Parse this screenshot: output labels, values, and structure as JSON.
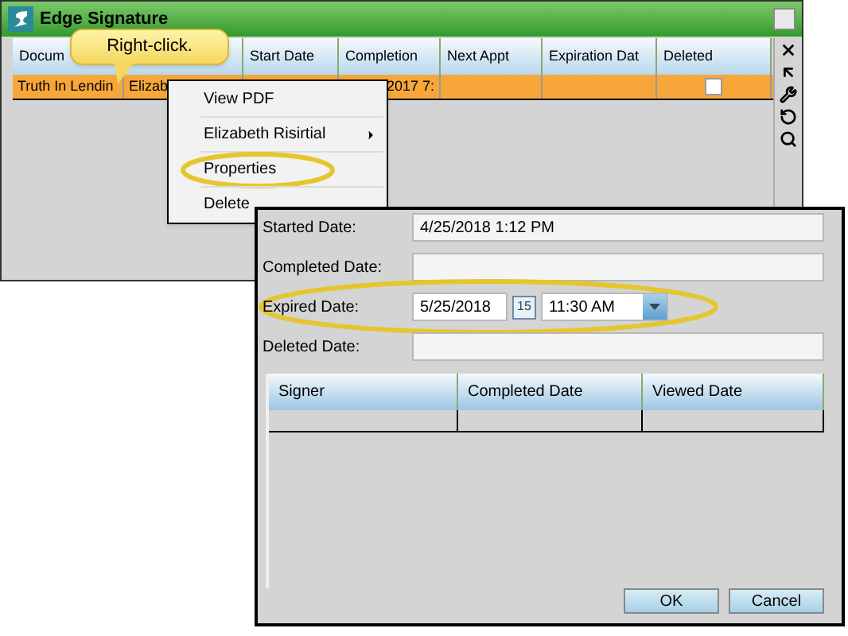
{
  "window": {
    "title": "Edge Signature"
  },
  "callout": {
    "text": "Right-click."
  },
  "table": {
    "columns": [
      {
        "label": "Docum"
      },
      {},
      {
        "label": "Start Date"
      },
      {
        "label": "Completion"
      },
      {
        "label": "Next Appt"
      },
      {
        "label": "Expiration Dat"
      },
      {
        "label": "Deleted"
      }
    ],
    "rows": [
      {
        "selected": true,
        "deleted": false,
        "cells": [
          "Truth In Lendin",
          "Elizab",
          null,
          "2017 7:",
          null,
          null
        ]
      }
    ]
  },
  "context_menu": {
    "items": [
      {
        "label": "View PDF",
        "submenu": false,
        "highlighted": false
      },
      {
        "label": "Elizabeth Risirtial",
        "submenu": true,
        "highlighted": false
      },
      {
        "label": "Properties",
        "submenu": false,
        "highlighted": true
      },
      {
        "label": "Delete",
        "submenu": false,
        "highlighted": false
      }
    ]
  },
  "dialog": {
    "fields": [
      {
        "kind": "text",
        "label": "Started Date:",
        "value": "4/25/2018 1:12 PM",
        "highlighted": false
      },
      {
        "kind": "text",
        "label": "Completed Date:",
        "highlighted": false
      },
      {
        "kind": "datetime",
        "label": "Expired Date:",
        "date": "5/25/2018",
        "calendar_day": "15",
        "time": "11:30 AM",
        "highlighted": true
      },
      {
        "kind": "text",
        "label": "Deleted Date:",
        "highlighted": false
      }
    ],
    "grid_columns": [
      "Signer",
      "Completed Date",
      "Viewed Date"
    ],
    "buttons": [
      "OK",
      "Cancel"
    ]
  }
}
